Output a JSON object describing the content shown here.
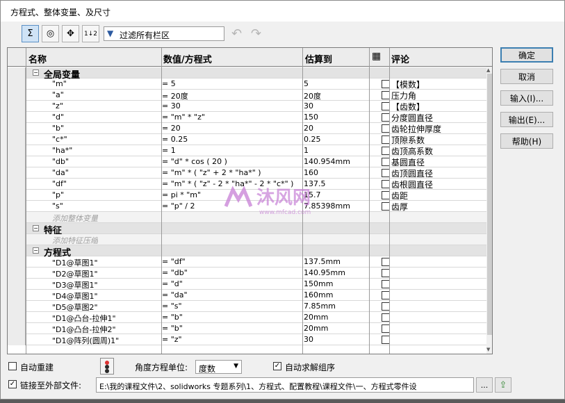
{
  "window": {
    "title": "方程式、整体变量、及尺寸"
  },
  "toolbar": {
    "buttons": [
      {
        "name": "equation-view-icon",
        "glyph": "Σ"
      },
      {
        "name": "sketch-equation-view-icon",
        "glyph": "◎"
      },
      {
        "name": "dimension-view-icon",
        "glyph": "✥"
      },
      {
        "name": "ordered-view-icon",
        "glyph": "1↓2"
      }
    ],
    "filter_placeholder": "过滤所有栏区"
  },
  "grid": {
    "headers": {
      "name": "名称",
      "value": "数值/方程式",
      "evaluates": "估算到",
      "comment": "评论"
    },
    "sections": {
      "globals": "全局变量",
      "features": "特征",
      "equations": "方程式"
    },
    "add_global": "添加整体变量",
    "add_feature": "添加特征压缩",
    "globals": [
      {
        "name": "\"m\"",
        "value": "= 5",
        "eval": "5",
        "comment": "【模数】"
      },
      {
        "name": "\"a\"",
        "value": "= 20度",
        "eval": "20度",
        "comment": "压力角"
      },
      {
        "name": "\"z\"",
        "value": "= 30",
        "eval": "30",
        "comment": "【齿数】"
      },
      {
        "name": "\"d\"",
        "value": "= \"m\" * \"z\"",
        "eval": "150",
        "comment": "分度圆直径"
      },
      {
        "name": "\"b\"",
        "value": "= 20",
        "eval": "20",
        "comment": "齿轮拉伸厚度"
      },
      {
        "name": "\"c*\"",
        "value": "= 0.25",
        "eval": "0.25",
        "comment": "顶隙系数"
      },
      {
        "name": "\"ha*\"",
        "value": "= 1",
        "eval": "1",
        "comment": "齿顶高系数"
      },
      {
        "name": "\"db\"",
        "value": "= \"d\" * cos ( 20 )",
        "eval": "140.954mm",
        "comment": "基圆直径"
      },
      {
        "name": "\"da\"",
        "value": "= \"m\" * ( \"z\" + 2 * \"ha*\" )",
        "eval": "160",
        "comment": "齿顶圆直径"
      },
      {
        "name": "\"df\"",
        "value": "= \"m\" * ( \"z\" - 2 * \"ha*\" - 2 * \"c*\" )",
        "eval": "137.5",
        "comment": "齿根圆直径"
      },
      {
        "name": "\"p\"",
        "value": "= pi * \"m\"",
        "eval": "15.7",
        "comment": "齿距"
      },
      {
        "name": "\"s\"",
        "value": "= \"p\" / 2",
        "eval": "7.85398mm",
        "comment": "齿厚"
      }
    ],
    "equations": [
      {
        "name": "\"D1@草图1\"",
        "value": "= \"df\"",
        "eval": "137.5mm"
      },
      {
        "name": "\"D2@草图1\"",
        "value": "= \"db\"",
        "eval": "140.95mm"
      },
      {
        "name": "\"D3@草图1\"",
        "value": "= \"d\"",
        "eval": "150mm"
      },
      {
        "name": "\"D4@草图1\"",
        "value": "= \"da\"",
        "eval": "160mm"
      },
      {
        "name": "\"D5@草图2\"",
        "value": "= \"s\"",
        "eval": "7.85mm"
      },
      {
        "name": "\"D1@凸台-拉伸1\"",
        "value": "= \"b\"",
        "eval": "20mm"
      },
      {
        "name": "\"D1@凸台-拉伸2\"",
        "value": "= \"b\"",
        "eval": "20mm"
      },
      {
        "name": "\"D1@阵列(圆周)1\"",
        "value": "= \"z\"",
        "eval": "30"
      }
    ]
  },
  "buttons": {
    "ok": "确定",
    "cancel": "取消",
    "import": "输入(I)...",
    "export": "输出(E)...",
    "help": "帮助(H)"
  },
  "bottom": {
    "auto_rebuild": "自动重建",
    "angle_unit_label": "角度方程单位:",
    "angle_unit_value": "度数",
    "auto_solve": "自动求解组序",
    "link_external": "链接至外部文件:",
    "path": "E:\\我的课程文件\\2、solidworks 专题系列\\1、方程式、配置教程\\课程文件\\一、方程式零件设"
  },
  "watermark": {
    "brand": "沐风网",
    "url": "www.mfcad.com"
  },
  "colors": {
    "accent": "#3c7fb1",
    "watermark": "#c77fd6"
  }
}
